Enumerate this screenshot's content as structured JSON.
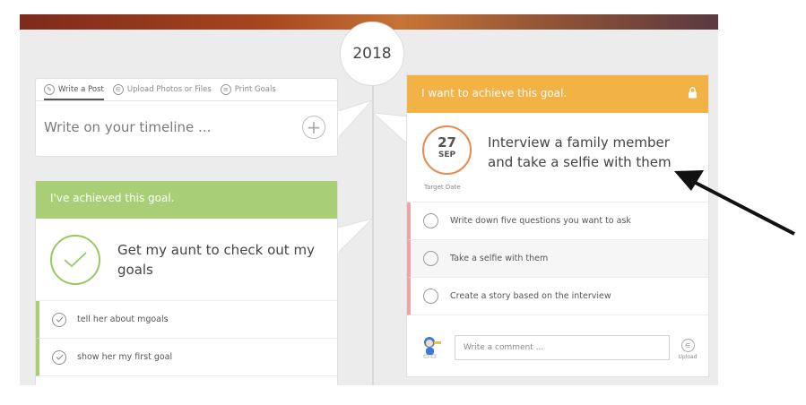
{
  "timeline": {
    "year": "2018"
  },
  "post_box": {
    "tabs": [
      {
        "label": "Write a Post",
        "icon": "pencil-icon"
      },
      {
        "label": "Upload Photos or Files",
        "icon": "paperclip-icon"
      },
      {
        "label": "Print Goals",
        "icon": "print-icon"
      }
    ],
    "placeholder": "Write on your timeline ...",
    "add_icon": "plus-icon"
  },
  "achieved_goal": {
    "header": "I've achieved this goal.",
    "title": "Get my aunt to check out my goals",
    "steps": [
      {
        "label": "tell her about mgoals"
      },
      {
        "label": "show her my first goal"
      }
    ],
    "accent": "#a9cf76"
  },
  "target_goal": {
    "header": "I want to achieve this goal.",
    "lock_icon": "lock-icon",
    "title": "Interview a family member and take a selfie with them",
    "date": {
      "day": "27",
      "month": "SEP",
      "caption": "Target Date"
    },
    "steps": [
      {
        "label": "Write down five questions you want to ask"
      },
      {
        "label": "Take a selfie with them"
      },
      {
        "label": "Create a story based on the interview"
      }
    ],
    "comment_placeholder": "Write a comment ...",
    "upload_label": "Upload",
    "accent": "#f3b246"
  },
  "colors": {
    "achieved_green": "#a9cf76",
    "goal_orange": "#f3b246",
    "date_ring": "#e98a4c",
    "task_marker": "#f0a3a3"
  }
}
